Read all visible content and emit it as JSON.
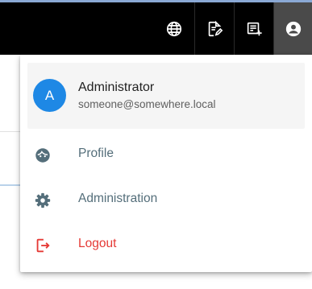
{
  "topbar": {
    "buttons": [
      {
        "icon": "globe-icon"
      },
      {
        "icon": "edit-document-icon"
      },
      {
        "icon": "add-note-icon"
      },
      {
        "icon": "account-circle-icon"
      }
    ]
  },
  "user_menu": {
    "avatar_initial": "A",
    "name": "Administrator",
    "email": "someone@somewhere.local",
    "items": [
      {
        "label": "Profile",
        "icon": "face-icon"
      },
      {
        "label": "Administration",
        "icon": "gear-icon"
      },
      {
        "label": "Logout",
        "icon": "logout-icon"
      }
    ]
  },
  "colors": {
    "topbar": "#000000",
    "avatar": "#1e88e5",
    "menu_text": "#546e7a",
    "logout": "#e53935"
  }
}
